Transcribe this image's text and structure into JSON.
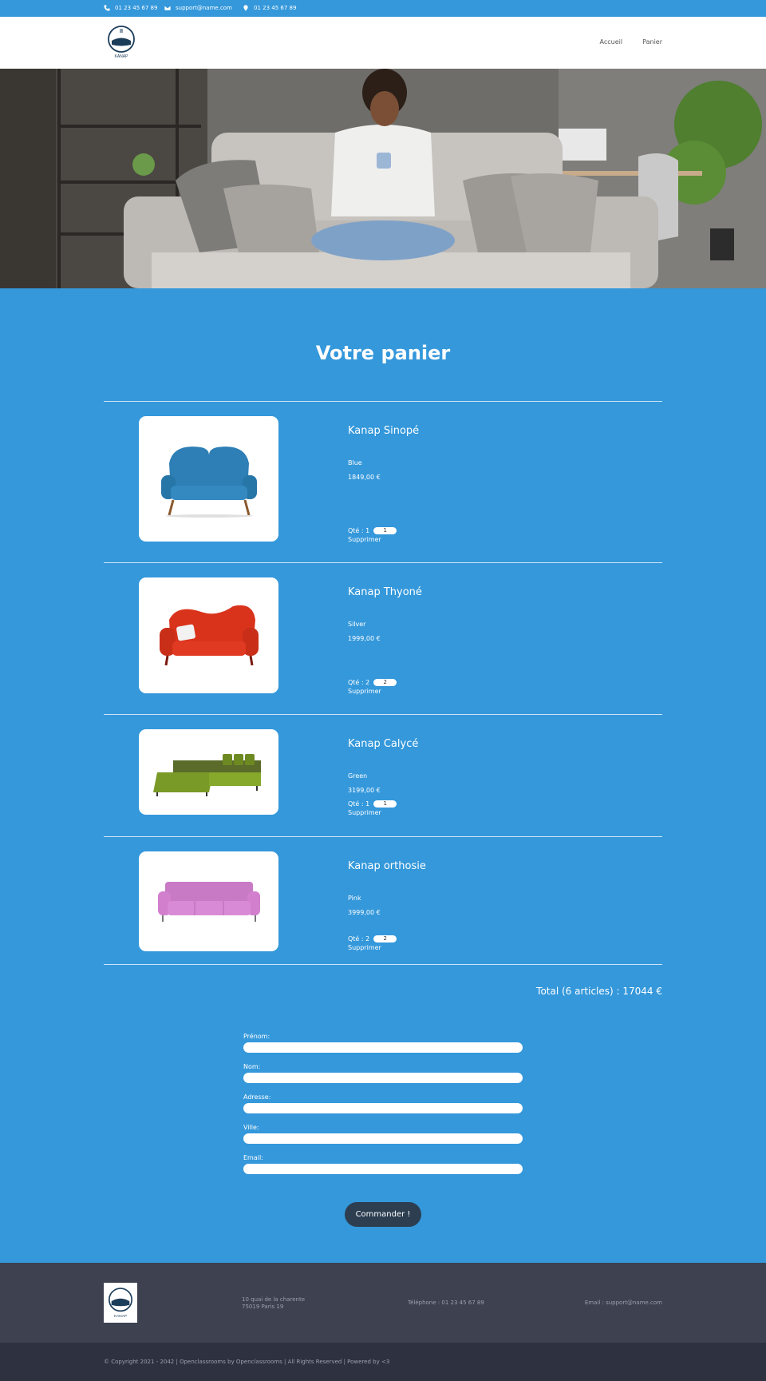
{
  "topbar": {
    "phone": "01 23 45 67 89",
    "email": "support@name.com",
    "location": "01 23 45 67 89"
  },
  "header": {
    "logo_text": "KANAP",
    "nav": [
      "Accueil",
      "Panier"
    ]
  },
  "cart": {
    "title": "Votre panier",
    "items": [
      {
        "name": "Kanap Sinopé",
        "color": "Blue",
        "price": "1849,00 €",
        "qty_label": "Qté : 1",
        "qty": "1",
        "delete": "Supprimer",
        "sofa_color": "#2d7fb5"
      },
      {
        "name": "Kanap Thyoné",
        "color": "Silver",
        "price": "1999,00 €",
        "qty_label": "Qté : 2",
        "qty": "2",
        "delete": "Supprimer",
        "sofa_color": "#d9331c"
      },
      {
        "name": "Kanap Calycé",
        "color": "Green",
        "price": "3199,00 €",
        "qty_label": "Qté : 1",
        "qty": "1",
        "delete": "Supprimer",
        "sofa_color": "#7a9a27"
      },
      {
        "name": "Kanap orthosie",
        "color": "Pink",
        "price": "3999,00 €",
        "qty_label": "Qté : 2",
        "qty": "2",
        "delete": "Supprimer",
        "sofa_color": "#d98ad6"
      }
    ],
    "total": "Total (6 articles) : 17044 €"
  },
  "form": {
    "fields": [
      {
        "label": "Prénom:",
        "value": ""
      },
      {
        "label": "Nom:",
        "value": ""
      },
      {
        "label": "Adresse:",
        "value": ""
      },
      {
        "label": "Ville:",
        "value": ""
      },
      {
        "label": "Email:",
        "value": ""
      }
    ],
    "submit": "Commander !"
  },
  "footer": {
    "address_line1": "10 quai de la charente",
    "address_line2": "75019 Paris 19",
    "phone": "Téléphone : 01 23 45 67 89",
    "email": "Email : support@name.com",
    "copyright": "© Copyright 2021 - 2042 | Openclassrooms by Openclassrooms | All Rights Reserved | Powered by <3"
  },
  "colors": {
    "primary": "#3498db",
    "dark_button": "#2c3e50",
    "footer": "#3d4150",
    "copyright_bar": "#2e3140"
  }
}
